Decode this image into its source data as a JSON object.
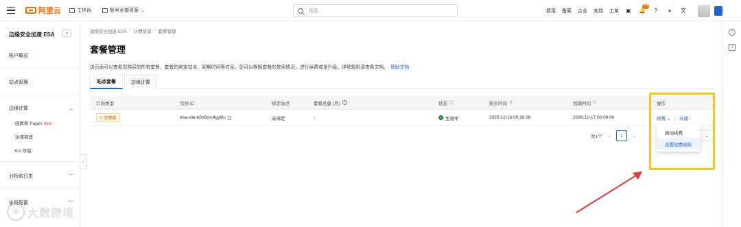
{
  "topbar": {
    "logo_text": "阿里云",
    "workbench": "工作台",
    "account_resources": "账号全部资源",
    "search_placeholder": "搜索...",
    "links": [
      "费用",
      "备案",
      "企业",
      "支持",
      "工单"
    ],
    "notification_count": "24"
  },
  "sidebar": {
    "title": "边缘安全加速 ESA",
    "collapse_label": "◂",
    "items": {
      "account_overview": "账户概览",
      "site_management": "站点管理",
      "edge_compute": "边缘计算",
      "functions_pages": "函数和 Pages",
      "new_tag": "NEW",
      "edge_container": "边缘容器",
      "kv_storage": "KV 存储",
      "analytics_logs": "分析和日志",
      "global_config": "全局配置"
    }
  },
  "breadcrumb": [
    "边缘安全加速 ESA",
    "计费管理",
    "套餐管理"
  ],
  "page": {
    "title": "套餐管理",
    "description": "该页面可以查看您购买的所有套餐、套餐的绑定站点、到期时间等信息。您可以根据套餐的使用情况，进行续费或是升级。详细规则请查看文档。",
    "help_link": "帮助文档"
  },
  "tabs": [
    "站点套餐",
    "边缘计算"
  ],
  "table": {
    "headers": [
      "订阅类型",
      "实例 ID",
      "绑定站点",
      "套餐总量 (月)",
      "状态",
      "购买时间",
      "到期时间",
      "操作"
    ],
    "rows": [
      {
        "subscription": "免费版",
        "instance_id": "esa-site-b0o8mc4gy8lc",
        "bound_site": "未绑定",
        "quota": "-",
        "status": "生效中",
        "purchase_time": "2025-12-16 09:36:36",
        "expire_time": "2026-12-17 00:00:00",
        "renew": "续费",
        "upgrade": "升级"
      }
    ]
  },
  "pagination": {
    "total": "共1个",
    "current_page": "1"
  },
  "renew_dropdown": [
    "自动续费",
    "设置续费规则"
  ],
  "watermark": "大数跨境",
  "colors": {
    "brand_orange": "#ff6a00",
    "link_blue": "#1b63d6",
    "highlight_yellow": "#f5c518",
    "arrow_red": "#e53935",
    "status_green": "#1b8a3a"
  }
}
